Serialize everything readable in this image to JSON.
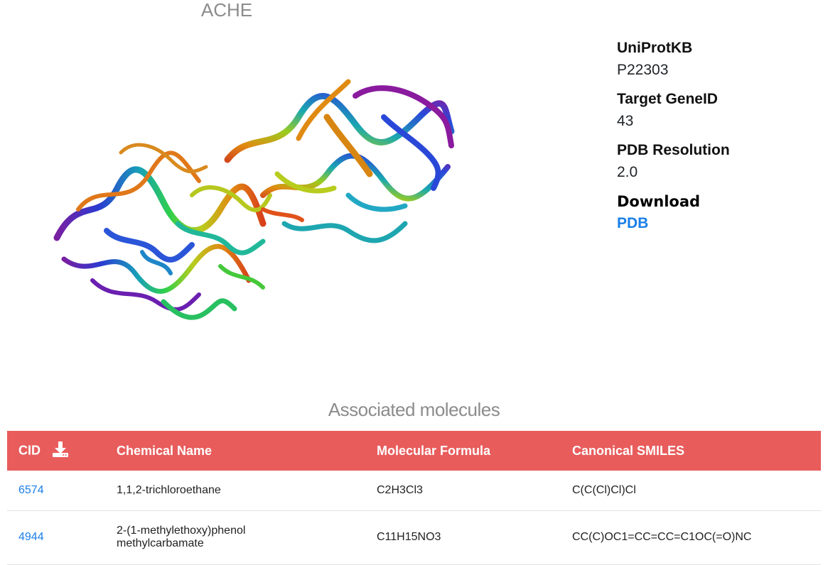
{
  "target": {
    "title": "ACHE"
  },
  "info": {
    "uniprot_label": "UniProtKB",
    "uniprot_value": "P22303",
    "geneid_label": "Target GeneID",
    "geneid_value": "43",
    "resolution_label": "PDB Resolution",
    "resolution_value": "2.0",
    "download_label": "Download",
    "pdb_link": "PDB"
  },
  "molecules": {
    "title": "Associated molecules",
    "headers": {
      "cid": "CID",
      "name": "Chemical Name",
      "formula": "Molecular Formula",
      "smiles": "Canonical SMILES"
    },
    "rows": [
      {
        "cid": "6574",
        "name": "1,1,2-trichloroethane",
        "formula": "C2H3Cl3",
        "smiles": "C(C(Cl)Cl)Cl"
      },
      {
        "cid": "4944",
        "name": "2-(1-methylethoxy)phenol methylcarbamate",
        "formula": "C11H15NO3",
        "smiles": "CC(C)OC1=CC=CC=C1OC(=O)NC"
      }
    ]
  },
  "colors": {
    "header_bg": "#e85c5c",
    "link": "#1a7fe8",
    "muted_title": "#8c8c8c"
  }
}
